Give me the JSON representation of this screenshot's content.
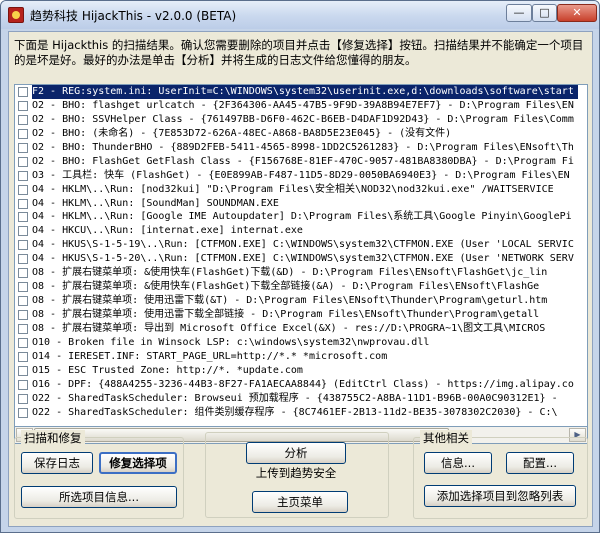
{
  "window": {
    "title": "趋势科技 HijackThis - v2.0.0 (BETA)",
    "controls": {
      "minimize": "—",
      "maximize": "□",
      "close": "✕"
    }
  },
  "intro": "下面是 Hijackthis 的扫描结果。确认您需要删除的项目并点击【修复选择】按钮。扫描结果并不能确定一个项目的是坏是好。最好的办法是单击【分析】并将生成的日志文件给您懂得的朋友。",
  "results": [
    "F2 - REG:system.ini: UserInit=C:\\WINDOWS\\system32\\userinit.exe,d:\\downloads\\software\\start",
    "O2 - BHO: flashget urlcatch - {2F364306-AA45-47B5-9F9D-39A8B94E7EF7} - D:\\Program Files\\EN",
    "O2 - BHO: SSVHelper Class - {761497BB-D6F0-462C-B6EB-D4DAF1D92D43} - D:\\Program Files\\Comm",
    "O2 - BHO: (未命名) - {7E853D72-626A-48EC-A868-BA8D5E23E045} - (没有文件)",
    "O2 - BHO: ThunderBHO - {889D2FEB-5411-4565-8998-1DD2C5261283} - D:\\Program Files\\ENsoft\\Th",
    "O2 - BHO: FlashGet GetFlash Class - {F156768E-81EF-470C-9057-481BA8380DBA} - D:\\Program Fi",
    "O3 - 工具栏: 快车 (FlashGet) - {E0E899AB-F487-11D5-8D29-0050BA6940E3} - D:\\Program Files\\EN",
    "O4 - HKLM\\..\\Run: [nod32kui] \"D:\\Program Files\\安全相关\\NOD32\\nod32kui.exe\" /WAITSERVICE",
    "O4 - HKLM\\..\\Run: [SoundMan] SOUNDMAN.EXE",
    "O4 - HKLM\\..\\Run: [Google IME Autoupdater] D:\\Program Files\\系统工具\\Google Pinyin\\GooglePi",
    "O4 - HKCU\\..\\Run: [internat.exe] internat.exe",
    "O4 - HKUS\\S-1-5-19\\..\\Run: [CTFMON.EXE] C:\\WINDOWS\\system32\\CTFMON.EXE (User 'LOCAL SERVIC",
    "O4 - HKUS\\S-1-5-20\\..\\Run: [CTFMON.EXE] C:\\WINDOWS\\system32\\CTFMON.EXE (User 'NETWORK SERV",
    "O8 - 扩展右键菜单项: &使用快车(FlashGet)下载(&D) - D:\\Program Files\\ENsoft\\FlashGet\\jc_lin",
    "O8 - 扩展右键菜单项: &使用快车(FlashGet)下载全部链接(&A) - D:\\Program Files\\ENsoft\\FlashGe",
    "O8 - 扩展右键菜单项: 使用迅雷下载(&T) - D:\\Program Files\\ENsoft\\Thunder\\Program\\geturl.htm",
    "O8 - 扩展右键菜单项: 使用迅雷下载全部链接 - D:\\Program Files\\ENsoft\\Thunder\\Program\\getall",
    "O8 - 扩展右键菜单项: 导出到 Microsoft Office Excel(&X) - res://D:\\PROGRA~1\\图文工具\\MICROS",
    "O10 - Broken file in Winsock LSP: c:\\windows\\system32\\nwprovau.dll",
    "O14 - IERESET.INF: START_PAGE_URL=http://*.*  *microsoft.com",
    "O15 - ESC Trusted Zone: http://*.  *update.com",
    "O16 - DPF: {488A4255-3236-44B3-8F27-FA1AECAA8844} (EditCtrl Class) - https://img.alipay.co",
    "O22 - SharedTaskScheduler: Browseui 预加载程序 - {438755C2-A8BA-11D1-B96B-00A0C90312E1} -",
    "O22 - SharedTaskScheduler: 组件类别缓存程序 - {8C7461EF-2B13-11d2-BE35-3078302C2030} - C:\\"
  ],
  "scrollbar": {
    "left_arrow": "◀",
    "right_arrow": "▶"
  },
  "group_scan_fix": {
    "legend": "扫描和修复",
    "save_log": "保存日志",
    "fix_selected": "修复选择项",
    "item_info": "所选项目信息..."
  },
  "group_center": {
    "analyze": "分析",
    "upload": "上传到趋势安全",
    "main_menu": "主页菜单"
  },
  "group_other": {
    "legend": "其他相关",
    "info": "信息...",
    "config": "配置...",
    "add_ignore": "添加选择项目到忽略列表"
  }
}
